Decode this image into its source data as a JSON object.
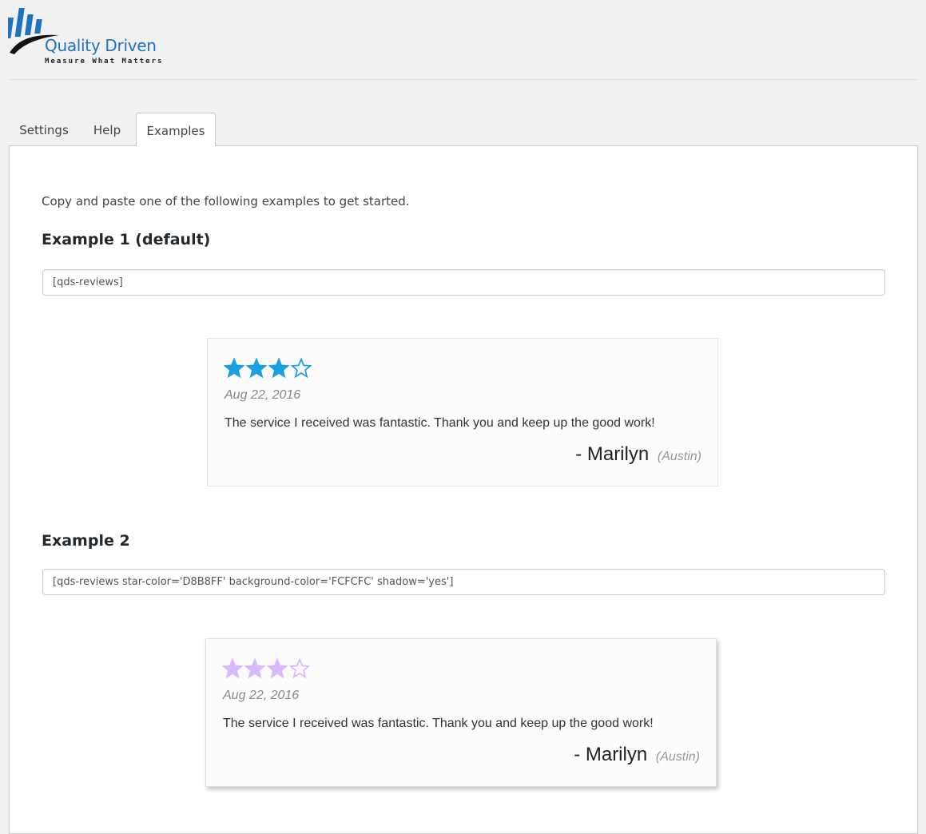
{
  "brand": {
    "name": "Quality Driven",
    "tagline": "Measure What Matters",
    "colors": {
      "blue": "#1e73be",
      "dark": "#222222"
    }
  },
  "tabs": [
    {
      "label": "Settings",
      "active": false
    },
    {
      "label": "Help",
      "active": false
    },
    {
      "label": "Examples",
      "active": true
    }
  ],
  "content": {
    "intro": "Copy and paste one of the following examples to get started.",
    "examples": [
      {
        "heading": "Example 1 (default)",
        "shortcode": "[qds-reviews]",
        "review": {
          "rating": 3,
          "max_rating": 4,
          "star_color": "#1a9fe0",
          "date": "Aug 22, 2016",
          "text": "The service I received was fantastic. Thank you and keep up the good work!",
          "author": "- Marilyn",
          "location": "(Austin)"
        }
      },
      {
        "heading": "Example 2",
        "shortcode": "[qds-reviews star-color='D8B8FF' background-color='FCFCFC' shadow='yes']",
        "review": {
          "rating": 3,
          "max_rating": 4,
          "star_color": "#d8b8ff",
          "date": "Aug 22, 2016",
          "text": "The service I received was fantastic. Thank you and keep up the good work!",
          "author": "- Marilyn",
          "location": "(Austin)"
        }
      }
    ]
  }
}
